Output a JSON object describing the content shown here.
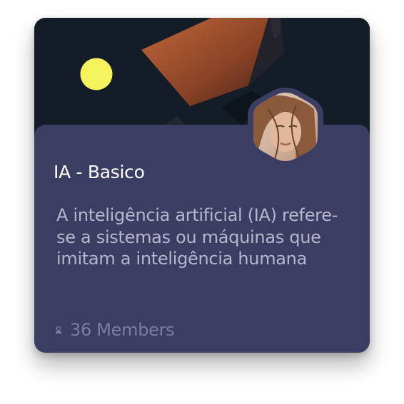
{
  "card": {
    "title": "IA - Basico",
    "description": "A inteligência artificial (IA) refere-se a sistemas ou máquinas que imitam a inteligência humana",
    "members": "36 Members",
    "member_icon": "person-icon",
    "cover_image": "abstract-3d-shapes",
    "avatar_image": "woman-portrait"
  },
  "colors": {
    "panel": "#3b3d63",
    "cover_bg": "#141c27",
    "title": "#ffffff",
    "description": "#b7b7cc",
    "meta": "#7c7e9e",
    "sun": "#f6f45e"
  }
}
